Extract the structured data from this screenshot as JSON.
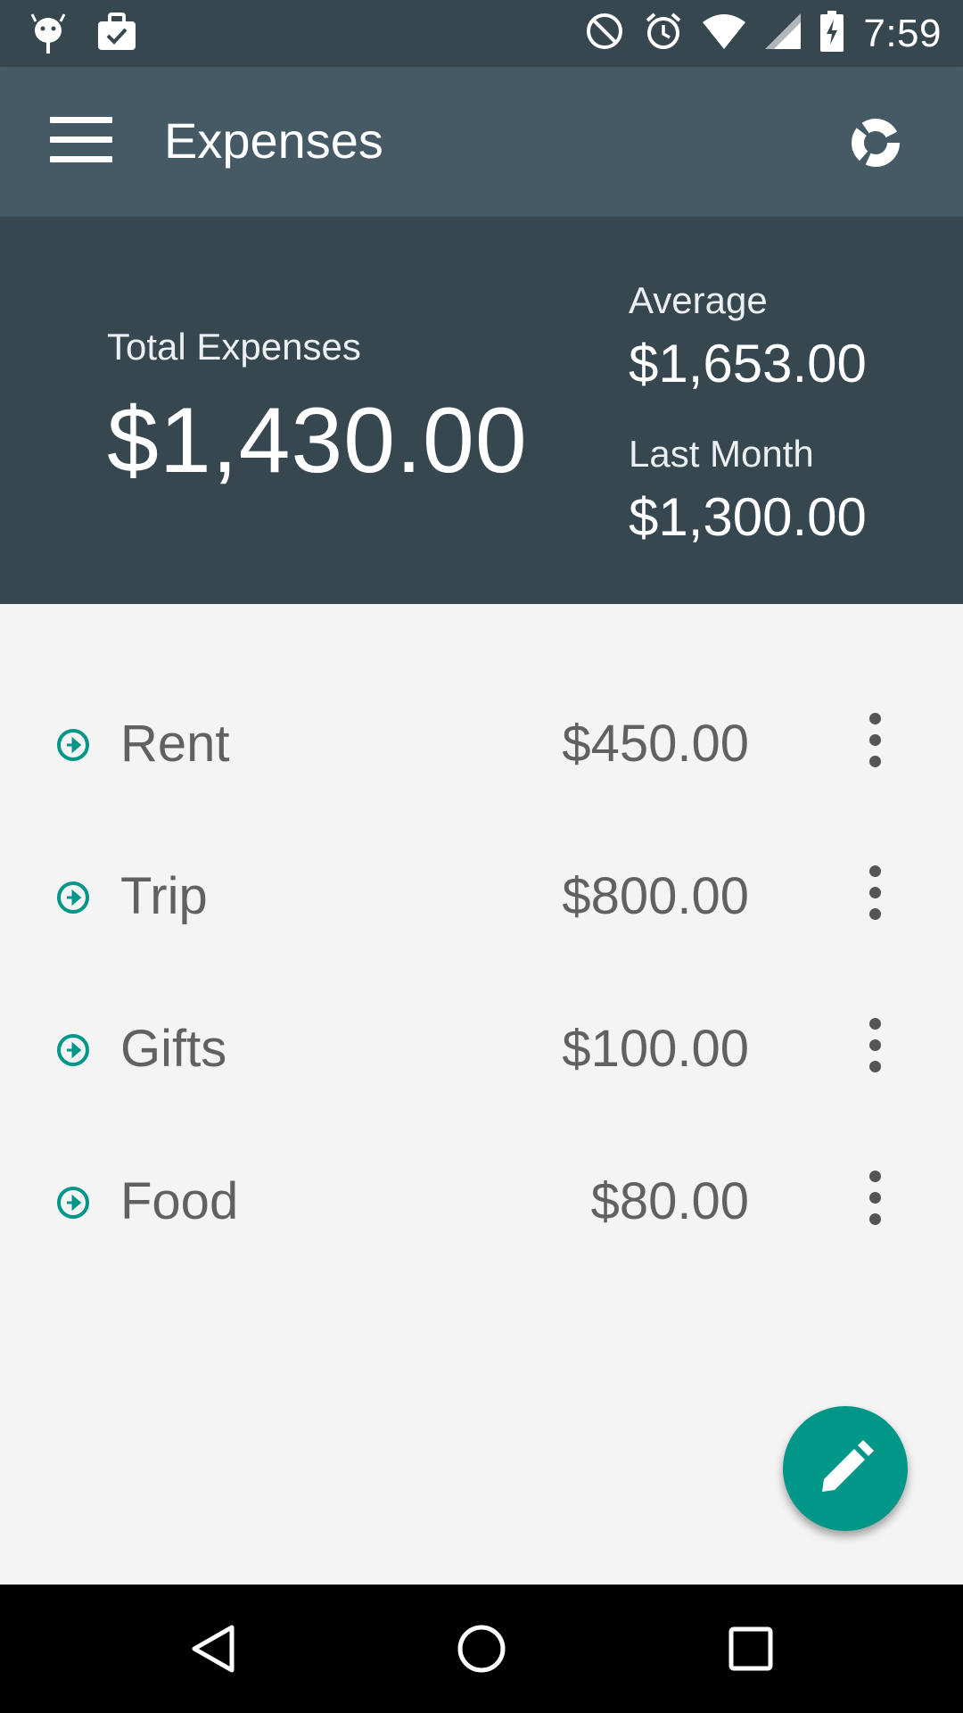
{
  "status_bar": {
    "time": "7:59",
    "icons": [
      "android-debug-icon",
      "work-briefcase-icon",
      "do-not-disturb-icon",
      "alarm-icon",
      "wifi-icon",
      "cell-signal-icon",
      "battery-charging-icon"
    ]
  },
  "app_bar": {
    "title": "Expenses",
    "menu_icon": "hamburger-menu-icon",
    "chart_icon": "donut-chart-icon"
  },
  "summary": {
    "total_label": "Total Expenses",
    "total_value": "$1,430.00",
    "average_label": "Average",
    "average_value": "$1,653.00",
    "last_month_label": "Last Month",
    "last_month_value": "$1,300.00"
  },
  "expenses": [
    {
      "name": "Rent",
      "amount": "$450.00"
    },
    {
      "name": "Trip",
      "amount": "$800.00"
    },
    {
      "name": "Gifts",
      "amount": "$100.00"
    },
    {
      "name": "Food",
      "amount": "$80.00"
    }
  ],
  "fab": {
    "icon": "edit-pencil-icon"
  },
  "nav_bar": {
    "icons": [
      "back-icon",
      "home-icon",
      "recents-icon"
    ]
  },
  "colors": {
    "status_bar": "#37474f",
    "app_bar": "#455a64",
    "summary_bg": "#37474f",
    "accent": "#009688",
    "list_bg": "#f4f4f4"
  }
}
